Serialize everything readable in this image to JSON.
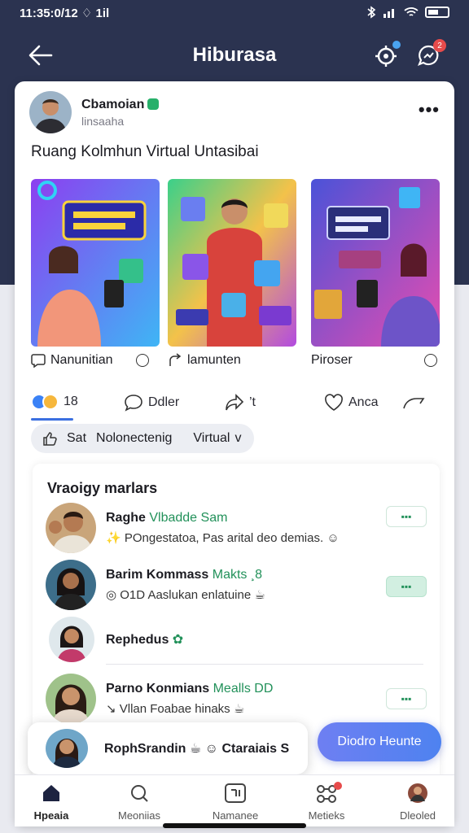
{
  "status_bar": {
    "time": "11:35:0/12 ♢ 1il"
  },
  "app_bar": {
    "title": "Hiburasa",
    "message_badge": "2"
  },
  "post": {
    "author_name": "Cbamoian",
    "author_subtitle": "linsaaha",
    "title": "Ruang Kolmhun Virtual Untasibai",
    "tiles": [
      {
        "label": "Nanunitian",
        "icon": "bubble-icon"
      },
      {
        "label": "lamunten",
        "icon": "share-icon"
      },
      {
        "label": "Piroser",
        "icon": "info-icon"
      }
    ],
    "actions": {
      "reaction_count": "18",
      "comment_label": "Ddler",
      "share_label": "’t",
      "like_label": "Anca"
    },
    "filter_pill": {
      "a": "Sat",
      "b": "Nolonectenig",
      "c": "Virtual",
      "d": "v"
    }
  },
  "members_panel": {
    "title": "Vraoigy  marlars",
    "members": [
      {
        "name": "Raghe",
        "tag": "Vlbadde Sam",
        "desc": "✨ POngestatoa, Pas arital  deo demias. ☺",
        "status": "▪▪▪"
      },
      {
        "name": "Barim Kommass",
        "tag": "Makts ¸8",
        "desc": "◎ O1D Aaslukan enlatuine ☕",
        "status": "▪▪▪"
      },
      {
        "name": "Rephedus",
        "tag": "",
        "desc": "",
        "status": ""
      },
      {
        "name": "Parno Konmians",
        "tag": "Mealls DD",
        "desc": "↘ Vllan Foabae hinaks ☕",
        "status": "▪▪▪"
      }
    ]
  },
  "float_card": {
    "text": "RophSrandin ☕ ☺ Ctaraiais S"
  },
  "float_button": {
    "label": "Diodro Heunte"
  },
  "bottom_nav": {
    "items": [
      {
        "label": "Hpeaia",
        "icon": "home-icon"
      },
      {
        "label": "Meoniias",
        "icon": "search-icon"
      },
      {
        "label": "Namanee",
        "icon": "grid-icon"
      },
      {
        "label": "Metieks",
        "icon": "people-icon"
      },
      {
        "label": "Dleoled",
        "icon": "profile-icon"
      }
    ]
  },
  "colors": {
    "header": "#2b3350",
    "accent": "#3b6fe0",
    "green": "#22915a"
  }
}
